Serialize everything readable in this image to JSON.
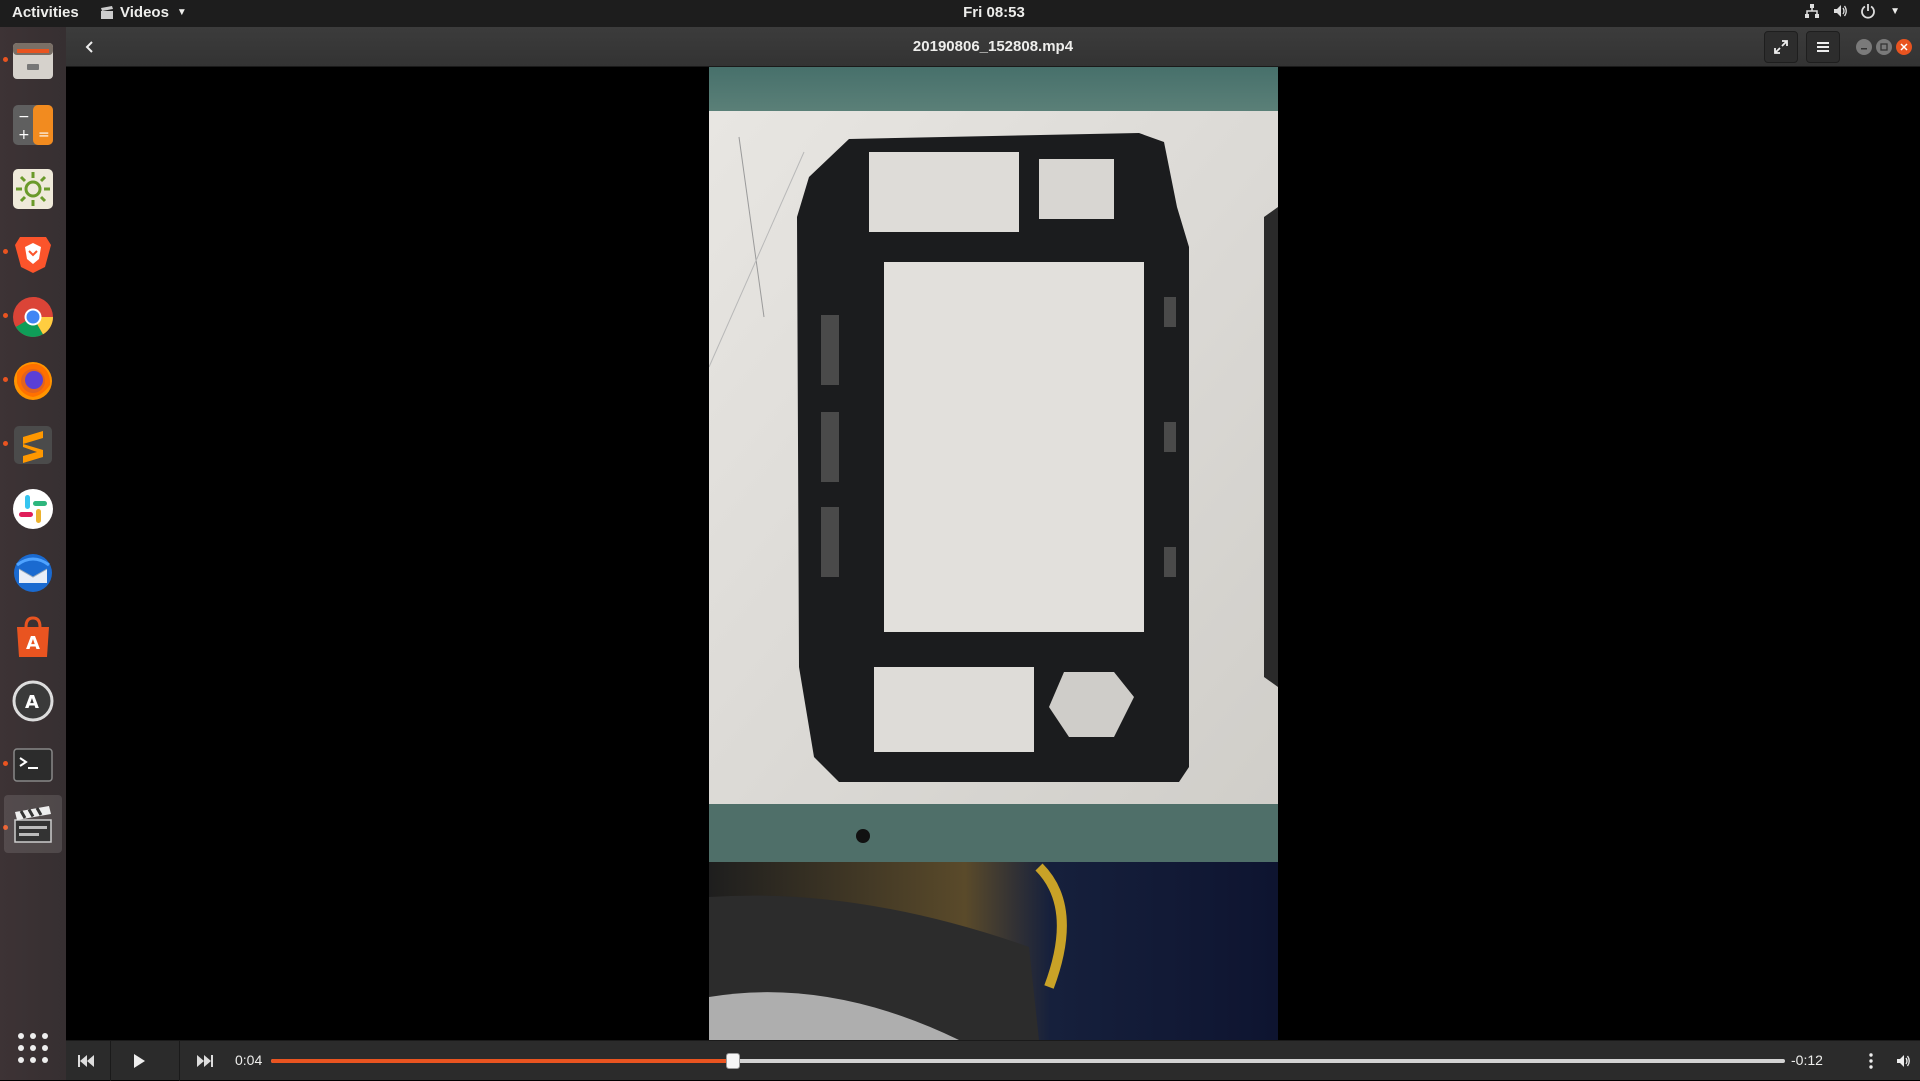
{
  "topbar": {
    "activities": "Activities",
    "app_menu": "Videos",
    "clock": "Fri 08:53"
  },
  "dock": {
    "items": [
      {
        "name": "files-app"
      },
      {
        "name": "calculator-app"
      },
      {
        "name": "brightness-app"
      },
      {
        "name": "brave-browser-app"
      },
      {
        "name": "chrome-browser-app"
      },
      {
        "name": "firefox-browser-app"
      },
      {
        "name": "sublime-text-app"
      },
      {
        "name": "slack-app"
      },
      {
        "name": "thunderbird-app"
      },
      {
        "name": "software-center-app"
      },
      {
        "name": "software-updater-app"
      },
      {
        "name": "terminal-app"
      },
      {
        "name": "videos-app"
      }
    ]
  },
  "header": {
    "title": "20190806_152808.mp4"
  },
  "controls": {
    "elapsed": "0:04",
    "remaining": "-0:12",
    "progress": 0.305
  },
  "colors": {
    "accent": "#e95420",
    "topbar": "#1d1d1d",
    "dock": "#3a3133",
    "headerbar": "#383838"
  }
}
